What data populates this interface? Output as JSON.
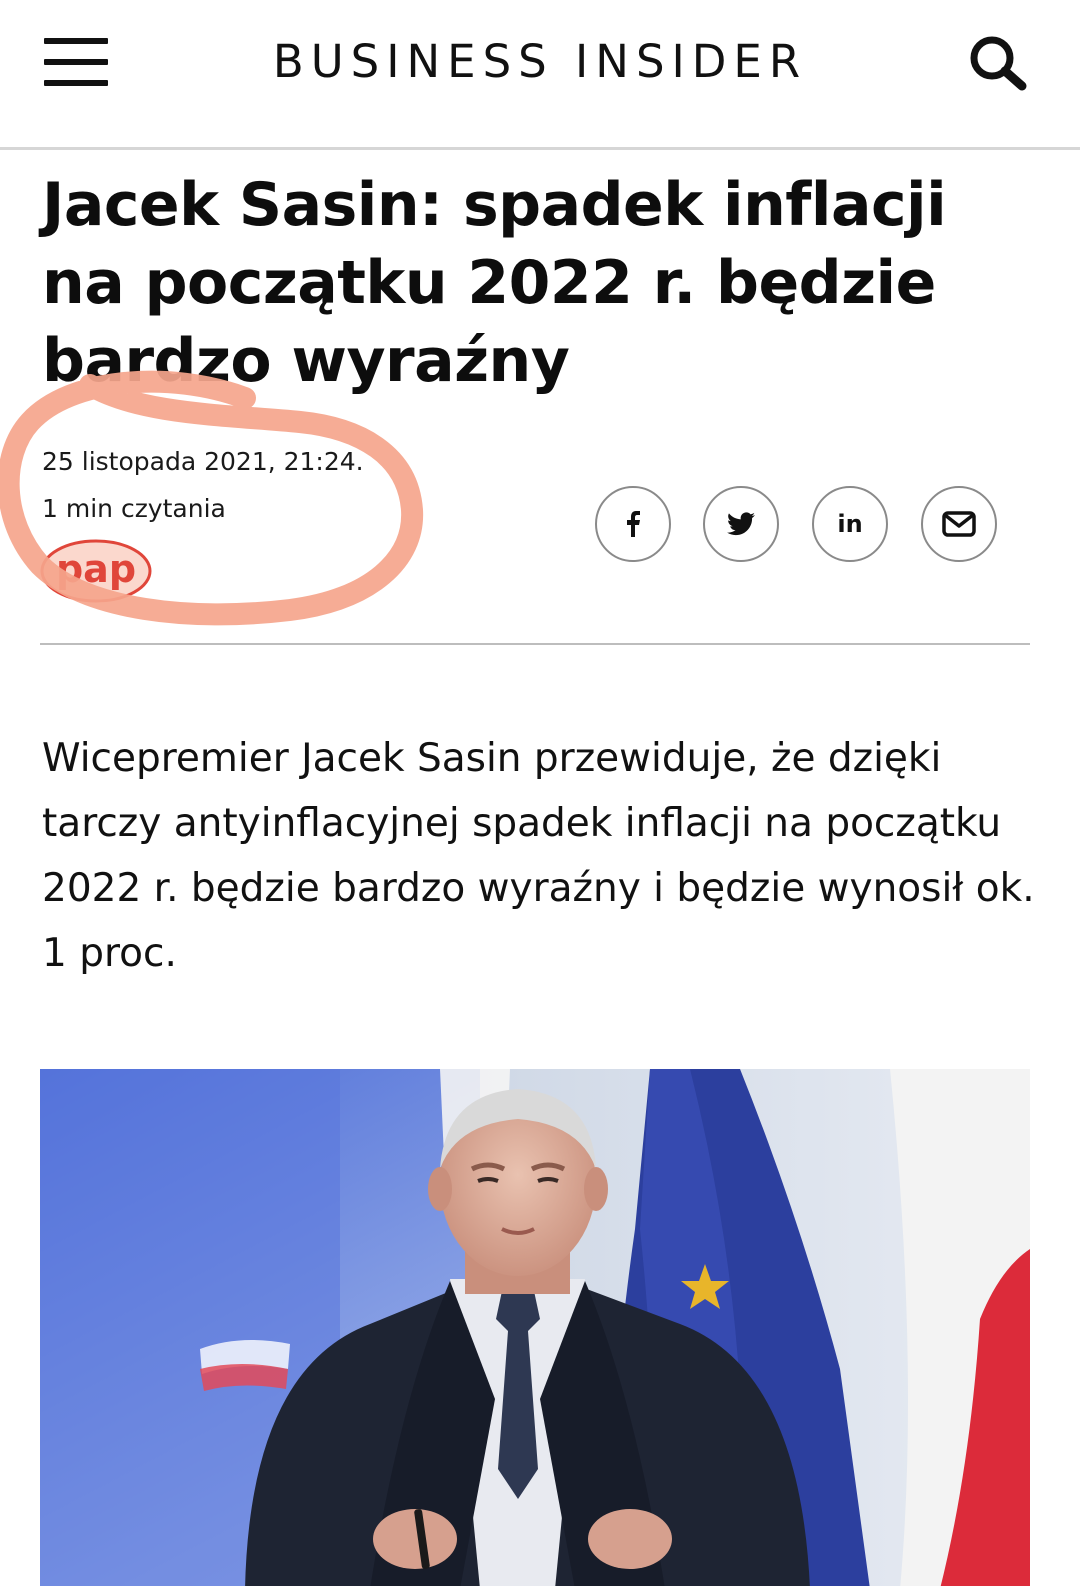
{
  "header": {
    "brand": "BUSINESS INSIDER",
    "menu_icon": "hamburger-menu-icon",
    "search_icon": "search-icon"
  },
  "article": {
    "headline": "Jacek Sasin: spadek inflacji na początku 2022 r. będzie bardzo wyraźny",
    "date": "25 listopada 2021, 21:24.",
    "read_time": "1 min czytania",
    "source_logo_text": "pap",
    "lead": "Wicepremier Jacek Sasin przewiduje, że dzięki tarczy antyinflacyjnej spadek inflacji na początku 2022 r. będzie bardzo wyraźny i będzie wynosił ok. 1 proc."
  },
  "share": [
    {
      "network": "facebook",
      "icon": "facebook-icon"
    },
    {
      "network": "twitter",
      "icon": "twitter-icon"
    },
    {
      "network": "linkedin",
      "icon": "linkedin-icon",
      "label": "in"
    },
    {
      "network": "email",
      "icon": "email-icon"
    }
  ],
  "colors": {
    "annotation": "#f5a58c",
    "pap_red": "#e0463a",
    "text": "#111111",
    "divider": "#d6d6d6"
  }
}
